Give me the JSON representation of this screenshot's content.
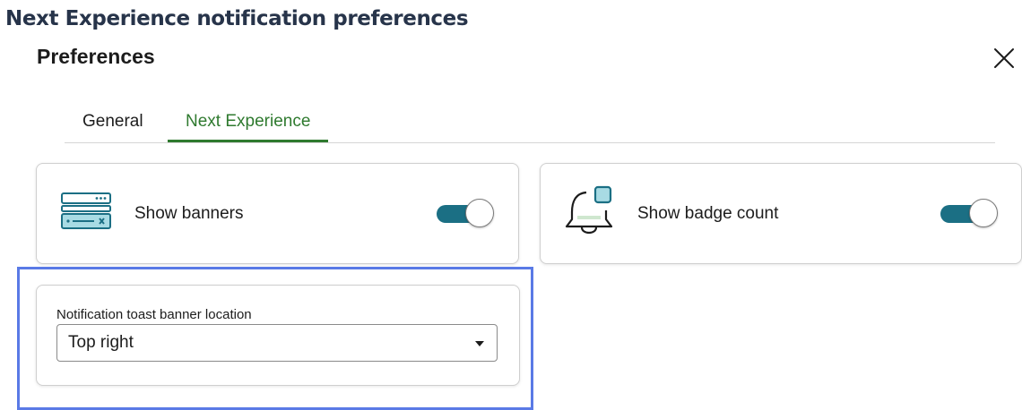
{
  "page": {
    "heading": "Next Experience notification preferences"
  },
  "dialog": {
    "title": "Preferences",
    "close_icon": "close-icon",
    "tabs": [
      {
        "label": "General",
        "selected": false
      },
      {
        "label": "Next Experience",
        "selected": true
      }
    ],
    "cards": {
      "show_banners": {
        "icon": "banner-icon",
        "label": "Show banners",
        "toggle_on": true
      },
      "show_badge_count": {
        "icon": "bell-badge-icon",
        "label": "Show badge count",
        "toggle_on": true
      }
    },
    "toast_location": {
      "label": "Notification toast banner location",
      "value": "Top right",
      "caret_icon": "caret-down-icon"
    }
  },
  "colors": {
    "heading": "#27344a",
    "tab_active": "#2f7a2f",
    "toggle_on": "#1b6f84",
    "highlight": "#5a7ae6",
    "icon_accent": "#1b6f84",
    "icon_fill": "#a8dbe4"
  }
}
